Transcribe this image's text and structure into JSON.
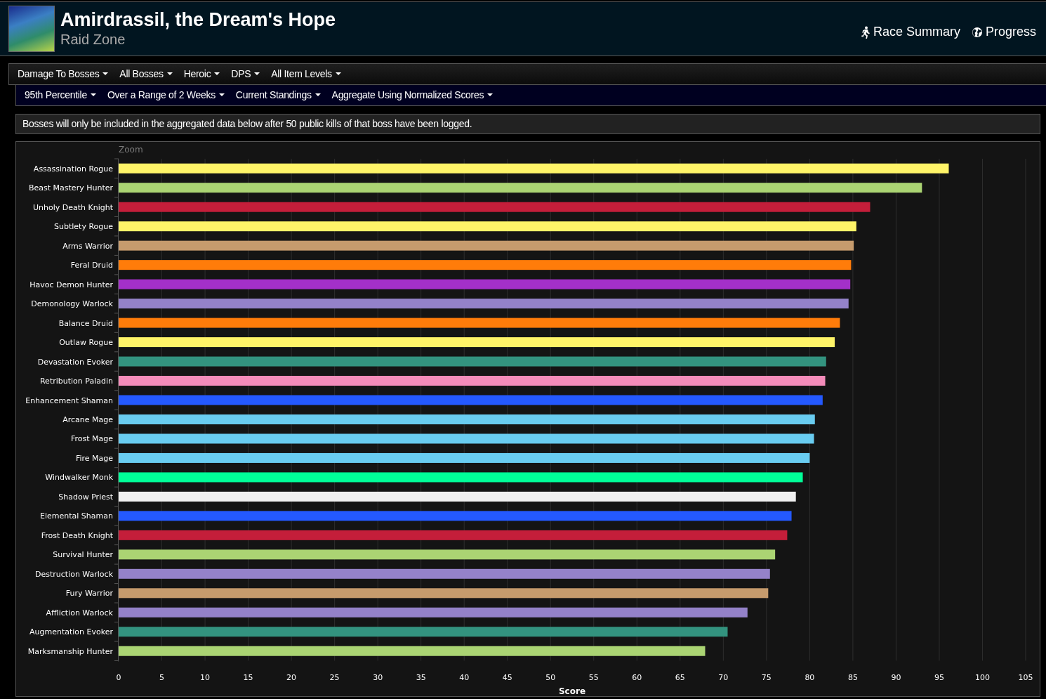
{
  "header": {
    "title": "Amirdrassil, the Dream's Hope",
    "subtitle": "Raid Zone",
    "links": [
      "Race Summary",
      "Progress"
    ]
  },
  "filters_primary": [
    "Damage To Bosses",
    "All Bosses",
    "Heroic",
    "DPS",
    "All Item Levels"
  ],
  "filters_secondary": [
    "95th Percentile",
    "Over a Range of 2 Weeks",
    "Current Standings",
    "Aggregate Using Normalized Scores"
  ],
  "notice": "Bosses will only be included in the aggregated data below after 50 public kills of that boss have been logged.",
  "chart": {
    "zoom_label": "Zoom",
    "chart_data": {
      "type": "bar",
      "orientation": "horizontal",
      "xlabel": "Score",
      "categories": [
        "Assassination Rogue",
        "Beast Mastery Hunter",
        "Unholy Death Knight",
        "Subtlety Rogue",
        "Arms Warrior",
        "Feral Druid",
        "Havoc Demon Hunter",
        "Demonology Warlock",
        "Balance Druid",
        "Outlaw Rogue",
        "Devastation Evoker",
        "Retribution Paladin",
        "Enhancement Shaman",
        "Arcane Mage",
        "Frost Mage",
        "Fire Mage",
        "Windwalker Monk",
        "Shadow Priest",
        "Elemental Shaman",
        "Frost Death Knight",
        "Survival Hunter",
        "Destruction Warlock",
        "Fury Warrior",
        "Affliction Warlock",
        "Augmentation Evoker",
        "Marksmanship Hunter"
      ],
      "series": [
        {
          "values": [
            96.1,
            93.0,
            87.0,
            85.4,
            85.1,
            84.8,
            84.7,
            84.5,
            83.5,
            82.9,
            81.9,
            81.8,
            81.5,
            80.6,
            80.5,
            80.0,
            79.2,
            78.4,
            77.9,
            77.4,
            76.0,
            75.4,
            75.2,
            72.8,
            70.5,
            67.9
          ],
          "colors": [
            "#fff468",
            "#abd473",
            "#c41e3a",
            "#fff468",
            "#c69b6d",
            "#ff7c0a",
            "#a330c9",
            "#9482c9",
            "#ff7c0a",
            "#fff468",
            "#33937f",
            "#f48cba",
            "#2459ff",
            "#69ccf0",
            "#69ccf0",
            "#69ccf0",
            "#00ff98",
            "#f0f0f0",
            "#2459ff",
            "#c41e3a",
            "#abd473",
            "#9482c9",
            "#c69b6d",
            "#9482c9",
            "#33937f",
            "#abd473"
          ]
        }
      ],
      "grid": true,
      "xlim": [
        0,
        105
      ],
      "xticks": [
        0,
        5,
        10,
        15,
        20,
        25,
        30,
        35,
        40,
        45,
        50,
        55,
        60,
        65,
        70,
        75,
        80,
        85,
        90,
        95,
        100,
        105
      ]
    }
  }
}
